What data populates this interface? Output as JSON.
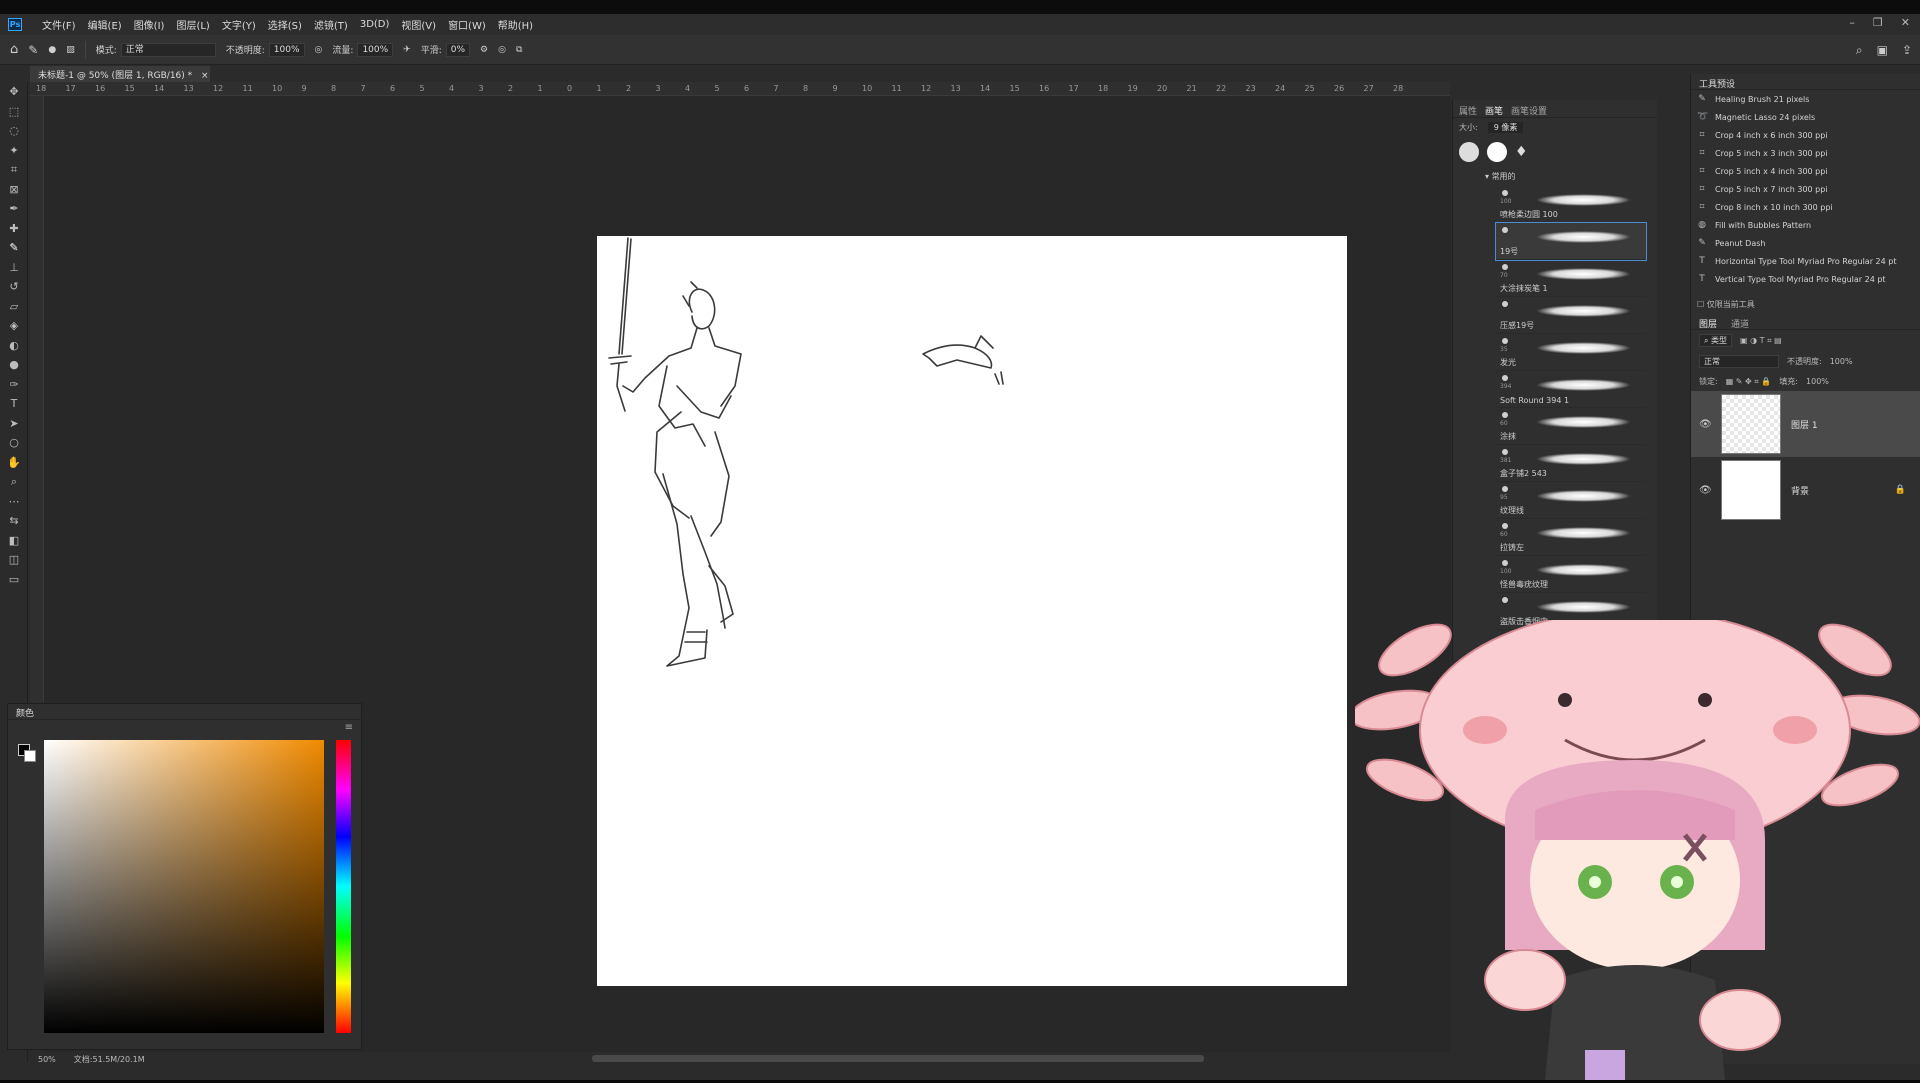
{
  "app": {
    "logo": "Ps"
  },
  "menu": [
    "文件(F)",
    "编辑(E)",
    "图像(I)",
    "图层(L)",
    "文字(Y)",
    "选择(S)",
    "滤镜(T)",
    "3D(D)",
    "视图(V)",
    "窗口(W)",
    "帮助(H)"
  ],
  "options": {
    "mode_label": "模式:",
    "mode_value": "正常",
    "opacity_label": "不透明度:",
    "opacity_value": "100%",
    "flow_label": "流量:",
    "flow_value": "100%",
    "smooth_label": "平滑:",
    "smooth_value": "0%"
  },
  "document": {
    "tab_title": "未标题-1 @ 50% (图层 1, RGB/16) *"
  },
  "ruler_labels": [
    "18",
    "17",
    "16",
    "15",
    "14",
    "13",
    "12",
    "11",
    "10",
    "9",
    "8",
    "7",
    "6",
    "5",
    "4",
    "3",
    "2",
    "1",
    "0",
    "1",
    "2",
    "3",
    "4",
    "5",
    "6",
    "7",
    "8",
    "9",
    "10",
    "11",
    "12",
    "13",
    "14",
    "15",
    "16",
    "17",
    "18",
    "19",
    "20",
    "21",
    "22",
    "23",
    "24",
    "25",
    "26",
    "27",
    "28"
  ],
  "color_panel": {
    "title": "颜色"
  },
  "status": {
    "zoom": "50%",
    "doc_info": "文档:51.5M/20.1M"
  },
  "brush_panel": {
    "tabs": [
      "属性",
      "画笔",
      "画笔设置"
    ],
    "size_label": "大小:",
    "size_value": "9 像素",
    "group_name": "常用的",
    "brushes": [
      {
        "num": "100",
        "name": "喷枪柔边圆 100"
      },
      {
        "num": "",
        "name": "19号"
      },
      {
        "num": "70",
        "name": "大涂抹炭笔 1"
      },
      {
        "num": "",
        "name": "压感19号"
      },
      {
        "num": "35",
        "name": "发光"
      },
      {
        "num": "394",
        "name": "Soft Round 394 1"
      },
      {
        "num": "60",
        "name": "涂抹"
      },
      {
        "num": "381",
        "name": "盒子铺2 543"
      },
      {
        "num": "95",
        "name": "纹理线"
      },
      {
        "num": "60",
        "name": "拉铸左"
      },
      {
        "num": "100",
        "name": "怪兽毒疣纹理"
      },
      {
        "num": "",
        "name": "盗版击香烟中"
      }
    ]
  },
  "tool_presets": {
    "title": "工具预设",
    "items": [
      {
        "icon": "brush-icon",
        "label": "Healing Brush 21 pixels"
      },
      {
        "icon": "lasso-icon",
        "label": "Magnetic Lasso 24 pixels"
      },
      {
        "icon": "crop-icon",
        "label": "Crop 4 inch x 6 inch 300 ppi"
      },
      {
        "icon": "crop-icon",
        "label": "Crop 5 inch x 3 inch 300 ppi"
      },
      {
        "icon": "crop-icon",
        "label": "Crop 5 inch x 4 inch 300 ppi"
      },
      {
        "icon": "crop-icon",
        "label": "Crop 5 inch x 7 inch 300 ppi"
      },
      {
        "icon": "crop-icon",
        "label": "Crop 8 inch x 10 inch 300 ppi"
      },
      {
        "icon": "pattern-icon",
        "label": "Fill with Bubbles Pattern"
      },
      {
        "icon": "brush-icon",
        "label": "Peanut Dash"
      },
      {
        "icon": "type-icon",
        "label": "Horizontal Type Tool Myriad Pro Regular 24 pt"
      },
      {
        "icon": "type-icon",
        "label": "Vertical Type Tool Myriad Pro Regular 24 pt"
      }
    ],
    "current_only": "仅限当前工具"
  },
  "layers_panel": {
    "tabs": [
      "图层",
      "通道"
    ],
    "filter_label": "类型",
    "blend_mode": "正常",
    "opacity_label": "不透明度:",
    "opacity_value": "100%",
    "lock_label": "锁定:",
    "fill_label": "填充:",
    "fill_value": "100%",
    "layers": [
      {
        "name": "图层 1",
        "selected": true
      },
      {
        "name": "背景",
        "locked": true
      }
    ]
  },
  "colors": {
    "accent": "#31a8ff",
    "selection": "#4a8cd8"
  }
}
